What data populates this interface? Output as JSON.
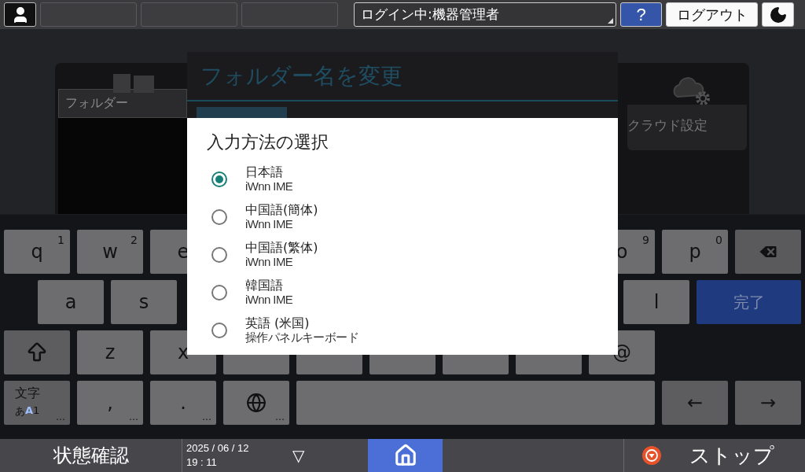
{
  "top_bar": {
    "login_status": "ログイン中:機器管理者",
    "help": "?",
    "logout": "ログアウト"
  },
  "background": {
    "folder_header": "フォルダー",
    "cloud_label": "クラウド設定",
    "rename_dialog": {
      "title": "フォルダー名を変更"
    }
  },
  "dialog": {
    "title": "入力方法の選択",
    "options": [
      {
        "name": "日本語",
        "engine": "iWnn IME",
        "selected": true
      },
      {
        "name": "中国語(簡体)",
        "engine": "iWnn IME",
        "selected": false
      },
      {
        "name": "中国語(繁体)",
        "engine": "iWnn IME",
        "selected": false
      },
      {
        "name": "韓国語",
        "engine": "iWnn IME",
        "selected": false
      },
      {
        "name": "英語 (米国)",
        "engine": "操作パネルキーボード",
        "selected": false
      }
    ]
  },
  "keyboard": {
    "rows": [
      {
        "left": [
          {
            "kind": "char",
            "label": "q",
            "sup": "1"
          },
          {
            "kind": "char",
            "label": "w",
            "sup": "2"
          },
          {
            "kind": "char",
            "label": "e"
          }
        ],
        "right": [
          {
            "kind": "char",
            "label": "o",
            "sup": "9"
          },
          {
            "kind": "char",
            "label": "p",
            "sup": "0"
          },
          {
            "kind": "backspace"
          }
        ]
      },
      {
        "left": [
          {
            "kind": "char",
            "label": "a"
          },
          {
            "kind": "char",
            "label": "s"
          }
        ],
        "right": [
          {
            "kind": "char",
            "label": "l"
          },
          {
            "kind": "done",
            "label": "完了"
          }
        ]
      },
      {
        "left": [
          {
            "kind": "shift"
          },
          {
            "kind": "char",
            "label": "z"
          },
          {
            "kind": "char",
            "label": "x"
          },
          {
            "kind": "char"
          },
          {
            "kind": "char"
          },
          {
            "kind": "char"
          },
          {
            "kind": "char"
          },
          {
            "kind": "char"
          },
          {
            "kind": "char",
            "label": "@"
          }
        ],
        "right": []
      },
      {
        "left": [
          {
            "kind": "mode",
            "label": "文字",
            "sub": [
              {
                "text": "あ",
                "selected": false
              },
              {
                "text": "A",
                "selected": true
              },
              {
                "text": "1",
                "selected": false
              }
            ],
            "more": "…"
          },
          {
            "kind": "char",
            "label": ",",
            "more": "…"
          },
          {
            "kind": "char",
            "label": ".",
            "more": "…"
          },
          {
            "kind": "globe",
            "more": "…"
          },
          {
            "kind": "space"
          },
          {
            "kind": "arrow",
            "label": "←"
          },
          {
            "kind": "arrow",
            "label": "→"
          }
        ],
        "right": []
      }
    ]
  },
  "bottom_bar": {
    "status": "状態確認",
    "date": "2025 / 06 / 12",
    "time": "19 : 11",
    "expand": "▽",
    "stop": "ストップ"
  }
}
